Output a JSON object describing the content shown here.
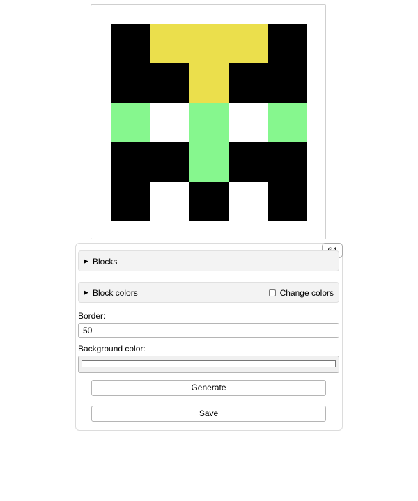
{
  "preview": {
    "palette": {
      "K": "#000000",
      "Y": "#ebdf4c",
      "G": "#86f78e",
      "W": "#ffffff"
    },
    "grid": [
      [
        "K",
        "Y",
        "Y",
        "Y",
        "K"
      ],
      [
        "K",
        "K",
        "Y",
        "K",
        "K"
      ],
      [
        "G",
        "W",
        "G",
        "W",
        "G"
      ],
      [
        "K",
        "K",
        "G",
        "K",
        "K"
      ],
      [
        "K",
        "W",
        "K",
        "W",
        "K"
      ]
    ]
  },
  "controls": {
    "block_count": "64",
    "blocks_section_label": "Blocks",
    "block_colors_section_label": "Block colors",
    "change_colors_label": "Change colors",
    "border_label": "Border:",
    "border_value": "50",
    "background_color_label": "Background color:",
    "background_color": "#ffffff",
    "generate_label": "Generate",
    "save_label": "Save"
  }
}
